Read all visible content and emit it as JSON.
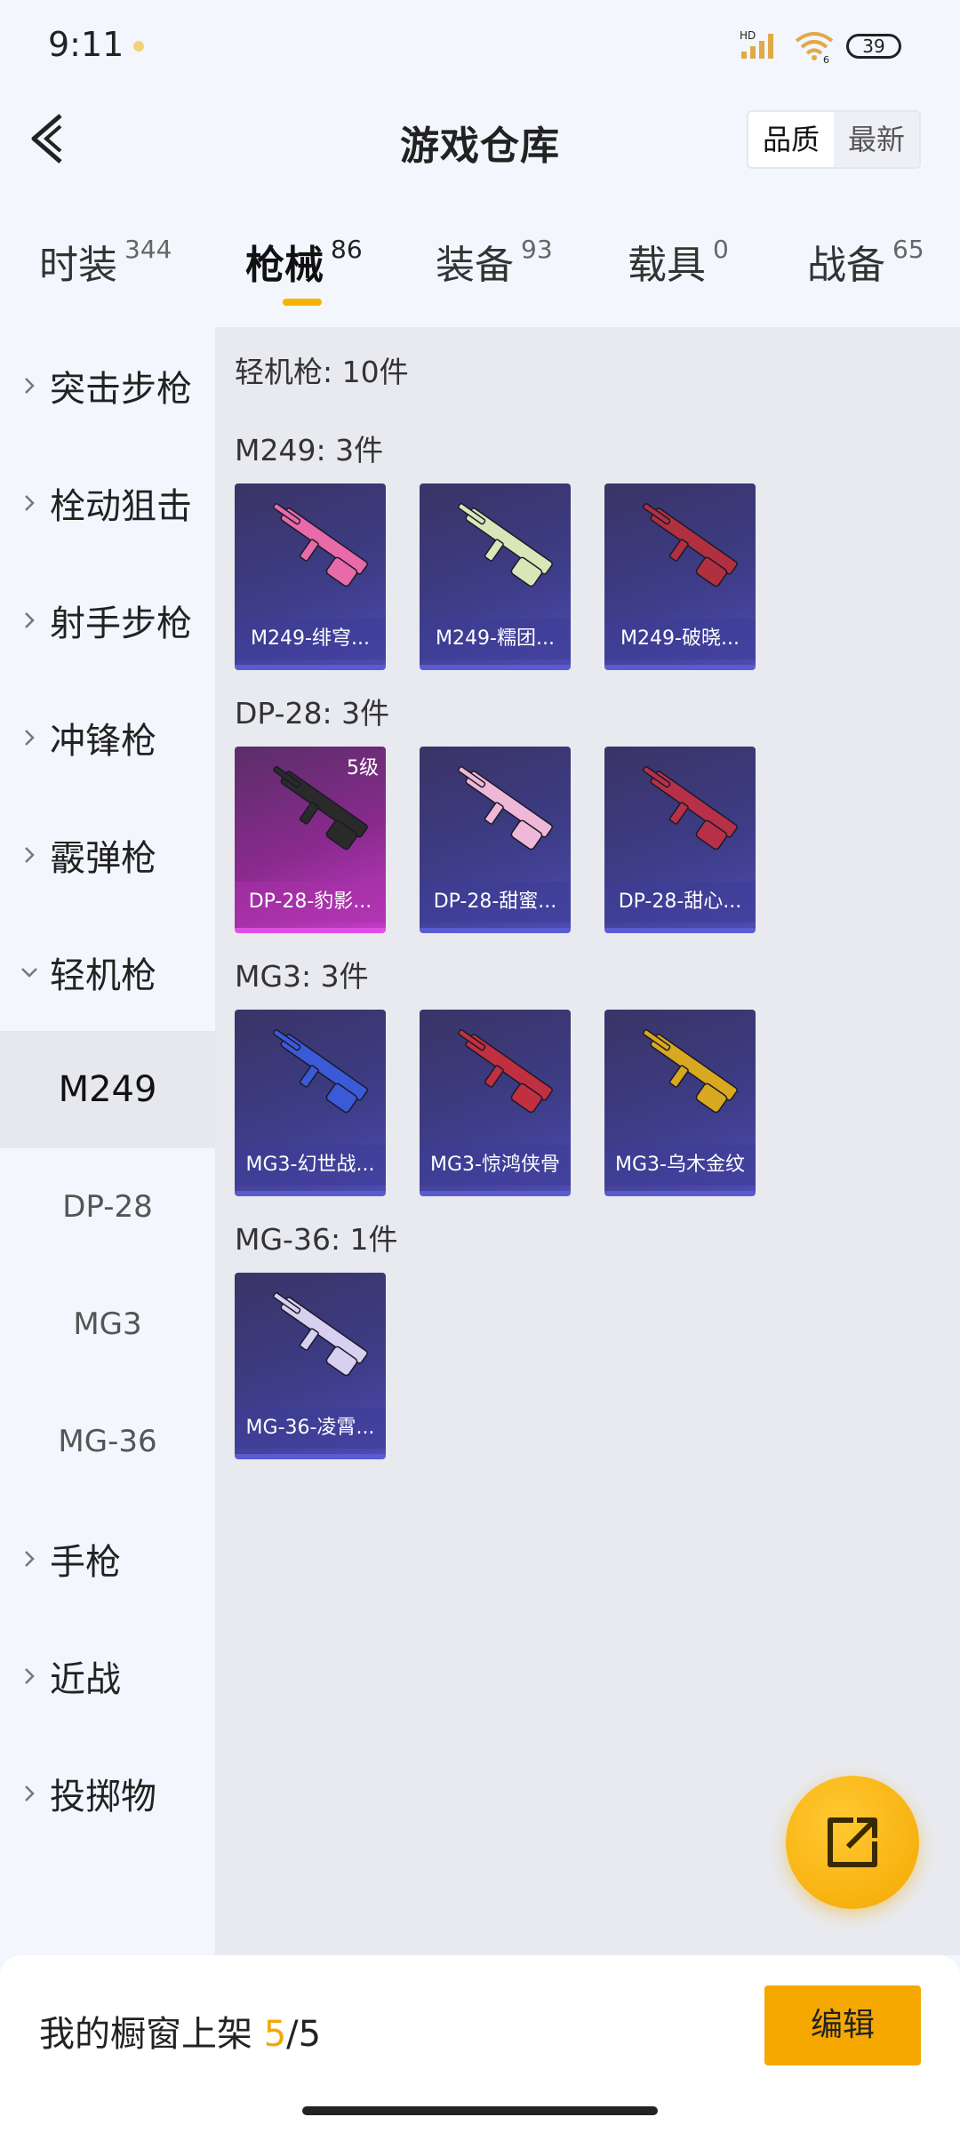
{
  "status": {
    "time": "9:11",
    "battery": "39",
    "signal_label": "HD",
    "wifi_sub": "6"
  },
  "header": {
    "title": "游戏仓库",
    "sort": [
      "品质",
      "最新"
    ]
  },
  "tabs": [
    {
      "label": "时装",
      "count": "344"
    },
    {
      "label": "枪械",
      "count": "86",
      "active": true
    },
    {
      "label": "装备",
      "count": "93"
    },
    {
      "label": "载具",
      "count": "0"
    },
    {
      "label": "战备",
      "count": "65"
    }
  ],
  "sidebar": {
    "categories": [
      "突击步枪",
      "栓动狙击",
      "射手步枪",
      "冲锋枪",
      "霰弹枪",
      "轻机枪",
      "手枪",
      "近战",
      "投掷物"
    ],
    "expanded": "轻机枪",
    "subitems": [
      "M249",
      "DP-28",
      "MG3",
      "MG-36"
    ],
    "active_sub": "M249"
  },
  "content": {
    "heading": "轻机枪: 10件",
    "groups": [
      {
        "title": "M249: 3件",
        "items": [
          {
            "name": "M249-绯穹...",
            "gun_color": "#e86aa8"
          },
          {
            "name": "M249-糯团...",
            "gun_color": "#d8e6b8"
          },
          {
            "name": "M249-破晓...",
            "gun_color": "#b03040"
          }
        ]
      },
      {
        "title": "DP-28: 3件",
        "items": [
          {
            "name": "DP-28-豹影...",
            "gun_color": "#2a2a2a",
            "level": "5级",
            "gold": true
          },
          {
            "name": "DP-28-甜蜜...",
            "gun_color": "#f0b8d8"
          },
          {
            "name": "DP-28-甜心...",
            "gun_color": "#b83048"
          }
        ]
      },
      {
        "title": "MG3: 3件",
        "items": [
          {
            "name": "MG3-幻世战...",
            "gun_color": "#3a5ad8"
          },
          {
            "name": "MG3-惊鸿侠骨",
            "gun_color": "#c03040"
          },
          {
            "name": "MG3-乌木金纹",
            "gun_color": "#d8a820"
          }
        ]
      },
      {
        "title": "MG-36: 1件",
        "items": [
          {
            "name": "MG-36-凌霄...",
            "gun_color": "#d8d0f0"
          }
        ]
      }
    ]
  },
  "bottom": {
    "label": "我的橱窗上架 ",
    "count": "5",
    "total": "/5",
    "edit": "编辑"
  },
  "colors": {
    "accent": "#f5a800",
    "card_blue": "#3d3c86",
    "card_purple": "#b03bb4"
  }
}
